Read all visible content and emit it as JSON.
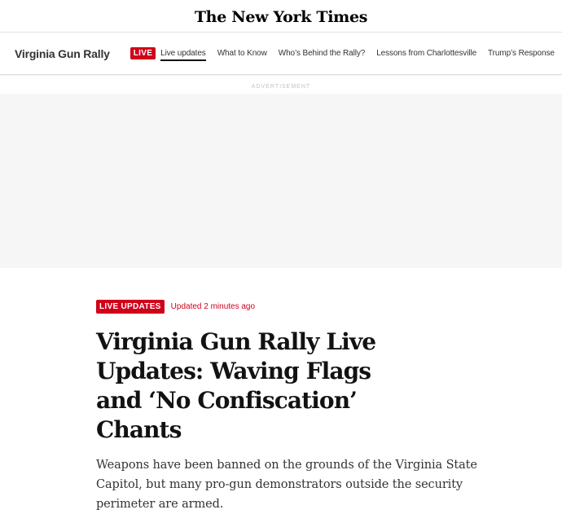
{
  "masthead": {
    "logo": "The New York Times"
  },
  "nav": {
    "section_title": "Virginia Gun Rally",
    "live_label": "LIVE",
    "links": [
      {
        "label": "Live updates"
      },
      {
        "label": "What to Know"
      },
      {
        "label": "Who’s Behind the Rally?"
      },
      {
        "label": "Lessons from Charlottesville"
      },
      {
        "label": "Trump’s Response"
      }
    ]
  },
  "ad": {
    "label": "ADVERTISEMENT"
  },
  "article": {
    "badge": "LIVE UPDATES",
    "updated": "Updated 2 minutes ago",
    "headline": "Virginia Gun Rally Live Updates: Waving Flags and ‘No Confiscation’ Chants",
    "summary": "Weapons have been banned on the grounds of the Virginia State Capitol, but many pro-gun demonstrators outside the security perimeter are armed."
  },
  "colors": {
    "accent": "#d0021b",
    "ad_background": "#f6f6f6"
  }
}
